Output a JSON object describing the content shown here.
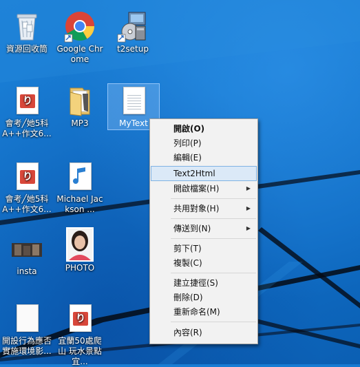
{
  "desktop": {
    "icons": [
      {
        "name": "recycle-bin",
        "label": "資源回收筒"
      },
      {
        "name": "google-chrome",
        "label": "Google Chrome"
      },
      {
        "name": "t2setup",
        "label": "t2setup"
      },
      {
        "name": "doc-1",
        "label": "會考╱她5科 A++作文6..."
      },
      {
        "name": "mp3-folder",
        "label": "MP3"
      },
      {
        "name": "mytext",
        "label": "MyText"
      },
      {
        "name": "doc-2",
        "label": "會考╱她5科 A++作文6..."
      },
      {
        "name": "michael-jackson",
        "label": "Michael Jackson ..."
      },
      {
        "name": "insta",
        "label": "insta"
      },
      {
        "name": "photo",
        "label": "PHOTO"
      },
      {
        "name": "doc-3",
        "label": "開設行為應否 實施環境影..."
      },
      {
        "name": "doc-4",
        "label": "宜蘭50處爬山 玩水景點 宜..."
      }
    ]
  },
  "context_menu": {
    "items": [
      {
        "label": "開啟(O)",
        "bold": true
      },
      {
        "label": "列印(P)"
      },
      {
        "label": "編輯(E)"
      },
      {
        "label": "Text2Html",
        "highlighted": true
      },
      {
        "label": "開啟檔案(H)",
        "submenu": "▶"
      },
      {
        "label": "共用對象(H)",
        "submenu": "▶"
      },
      {
        "label": "傳送到(N)",
        "submenu": "▶"
      },
      {
        "label": "剪下(T)"
      },
      {
        "label": "複製(C)"
      },
      {
        "label": "建立捷徑(S)"
      },
      {
        "label": "刪除(D)"
      },
      {
        "label": "重新命名(M)"
      },
      {
        "label": "內容(R)"
      }
    ]
  },
  "colors": {
    "desktop": "#1679d1",
    "menu_bg": "#f2f2f2",
    "highlight": "#dbe9f7",
    "doc_red": "#d8473a"
  }
}
